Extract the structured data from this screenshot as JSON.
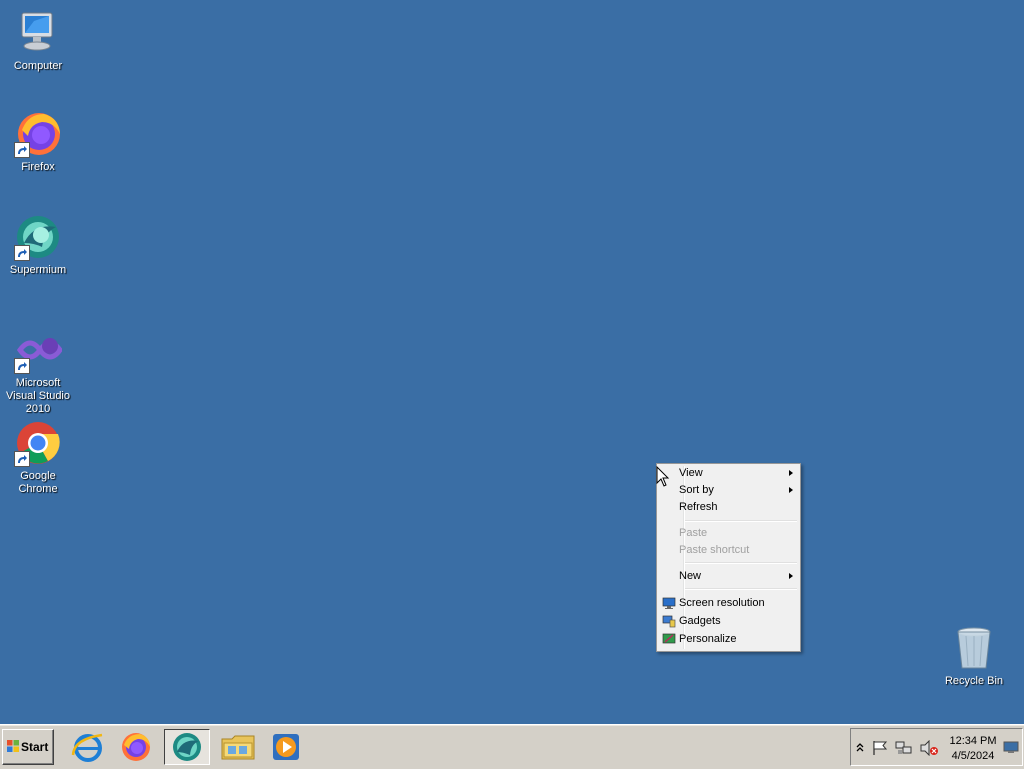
{
  "desktop": {
    "icons": [
      {
        "label": "Computer"
      },
      {
        "label": "Firefox"
      },
      {
        "label": "Supermium"
      },
      {
        "label": "Microsoft Visual Studio 2010"
      },
      {
        "label": "Google Chrome"
      },
      {
        "label": "Recycle Bin"
      }
    ]
  },
  "context_menu": {
    "items": [
      {
        "label": "View",
        "has_submenu": true,
        "enabled": true
      },
      {
        "label": "Sort by",
        "has_submenu": true,
        "enabled": true
      },
      {
        "label": "Refresh",
        "enabled": true
      },
      {
        "label": "Paste",
        "enabled": false
      },
      {
        "label": "Paste shortcut",
        "enabled": false
      },
      {
        "label": "New",
        "has_submenu": true,
        "enabled": true
      },
      {
        "label": "Screen resolution",
        "icon": "screen-resolution-icon",
        "enabled": true
      },
      {
        "label": "Gadgets",
        "icon": "gadgets-icon",
        "enabled": true
      },
      {
        "label": "Personalize",
        "icon": "personalize-icon",
        "enabled": true
      }
    ]
  },
  "taskbar": {
    "start_label": "Start",
    "pinned": [
      "internet-explorer-icon",
      "firefox-icon",
      "supermium-icon",
      "file-explorer-icon",
      "media-player-icon"
    ],
    "clock": {
      "time": "12:34 PM",
      "date": "4/5/2024"
    }
  },
  "colors": {
    "desktop_bg": "#3a6ea5",
    "taskbar_bg": "#d4d0c8",
    "menu_bg": "#f0f0f0"
  }
}
